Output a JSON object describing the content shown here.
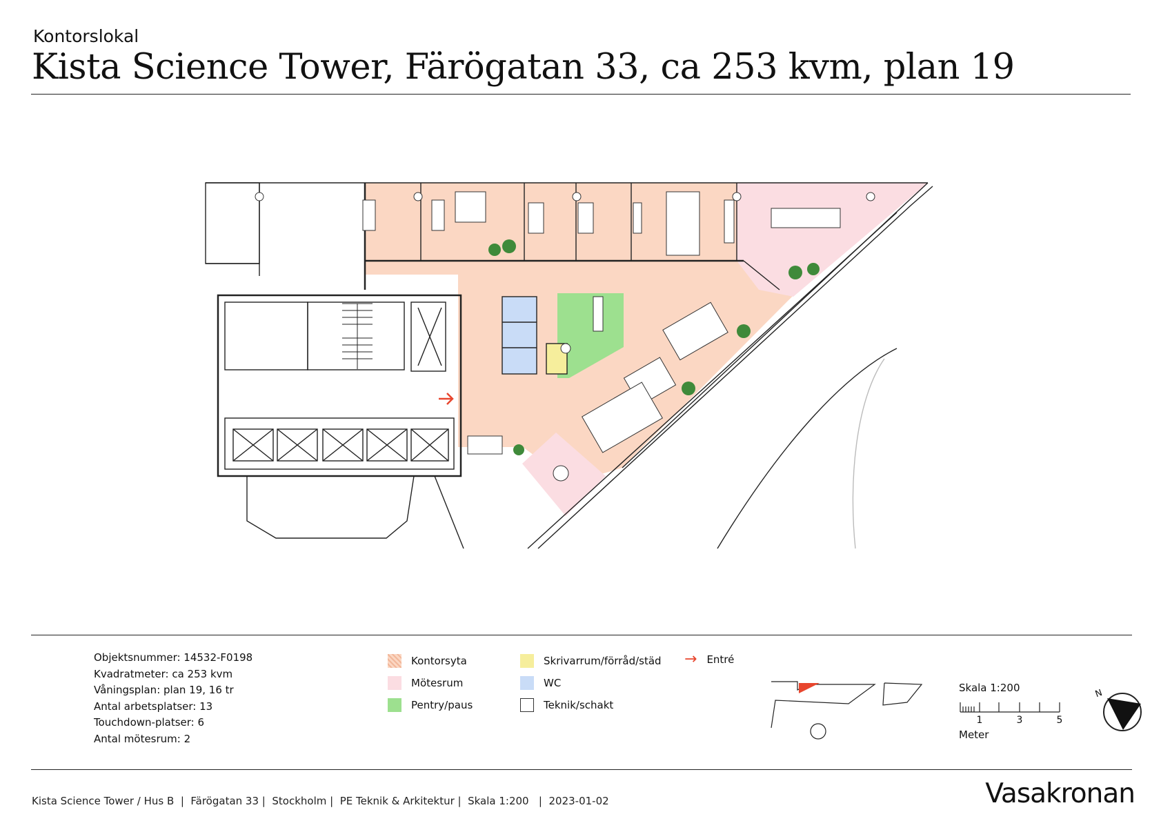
{
  "header": {
    "eyebrow": "Kontorslokal",
    "title": "Kista Science Tower, Färögatan 33, ca 253 kvm, plan 19"
  },
  "facts": [
    "Objektsnummer: 14532-F0198",
    "Kvadratmeter: ca 253 kvm",
    "Våningsplan: plan 19, 16 tr",
    "Antal arbetsplatser: 13",
    "Touchdown-platser: 6",
    "Antal mötesrum: 2"
  ],
  "legend": [
    {
      "label": "Kontorsyta",
      "color": "#fbd7c3",
      "icon": "hatched-swatch"
    },
    {
      "label": "Mötesrum",
      "color": "#fbdde2",
      "icon": "swatch"
    },
    {
      "label": "Pentry/paus",
      "color": "#9de08f",
      "icon": "swatch"
    },
    {
      "label": "Skrivarrum/förråd/städ",
      "color": "#f6ee9c",
      "icon": "swatch"
    },
    {
      "label": "WC",
      "color": "#c9dcf7",
      "icon": "swatch"
    },
    {
      "label": "Teknik/schakt",
      "color": "#ffffff",
      "icon": "outlined-swatch"
    },
    {
      "label": "Entré",
      "color": "#e8462e",
      "icon": "arrow-right-icon"
    }
  ],
  "scale": {
    "label": "Skala 1:200",
    "ticks": [
      "1",
      "3",
      "5"
    ],
    "unit": "Meter"
  },
  "compass": {
    "label": "N",
    "icon": "north-arrow-icon"
  },
  "footer": {
    "text": "Kista Science Tower / Hus B  |  Färögatan 33 |  Stockholm |  PE Teknik & Arkitektur |  Skala 1:200   |  2023-01-02",
    "brand": "Vasakronan"
  },
  "colors": {
    "office": "#fbd7c3",
    "meeting": "#fbdde2",
    "pantry": "#9de08f",
    "storage": "#f6ee9c",
    "wc": "#c9dcf7",
    "entrance": "#e8462e",
    "tree": "#3f8a3a"
  }
}
